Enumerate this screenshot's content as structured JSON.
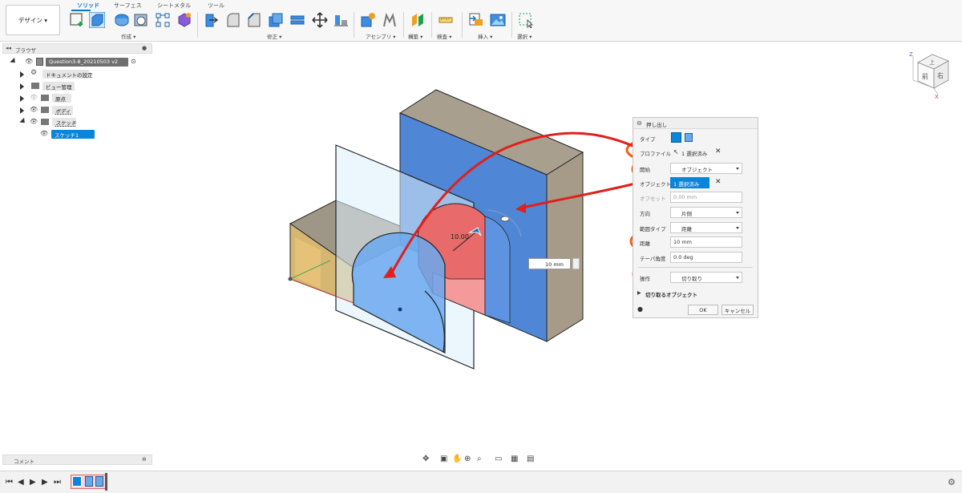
{
  "toolbar": {
    "workspace_button": "デザイン ▾",
    "tabs": [
      "ソリッド",
      "サーフェス",
      "シートメタル",
      "ツール"
    ],
    "groups": [
      "作成 ▾",
      "修正 ▾",
      "アセンブリ ▾",
      "構築 ▾",
      "検査 ▾",
      "挿入 ▾",
      "選択 ▾"
    ]
  },
  "browser": {
    "title": "ブラウザ",
    "root": "Question3-8_20210503 v2",
    "items": [
      "ドキュメントの設定",
      "ビュー管理",
      "原点",
      "ボディ",
      "スケッチ",
      "スケッチ1"
    ]
  },
  "comment_bar": {
    "label": "コメント"
  },
  "viewcube": {
    "axis_z": "Z",
    "axis_x": "X",
    "top_face": "上",
    "front_face": "前",
    "right_face": "右"
  },
  "canvas": {
    "dimension_label": "10.00",
    "distance_value": "10 mm"
  },
  "extrude_dialog": {
    "title": "押し出し",
    "type_label": "タイプ",
    "profile_label": "プロファイル",
    "profile_value": "1 選択済み",
    "start_label": "開始",
    "start_value": "オブジェクト",
    "object_label": "オブジェクト",
    "object_value": "1 選択済み",
    "offset_label": "オフセット",
    "offset_value": "0.00 mm",
    "direction_label": "方向",
    "direction_value": "片側",
    "extent_label": "範囲タイプ",
    "extent_value": "距離",
    "distance_label": "距離",
    "distance_value": "10 mm",
    "taper_label": "テーパ角度",
    "taper_value": "0.0 deg",
    "operation_label": "操作",
    "operation_value": "切り取り",
    "cut_objects_label": "切り取るオブジェクト",
    "ok_label": "OK",
    "cancel_label": "キャンセル"
  },
  "colors": {
    "accent": "#0a75c9",
    "selection_blue": "#4f86d6",
    "annotation_orange": "#f06010",
    "annotation_red": "#e0201a",
    "body_tan": "#a89f8e"
  }
}
